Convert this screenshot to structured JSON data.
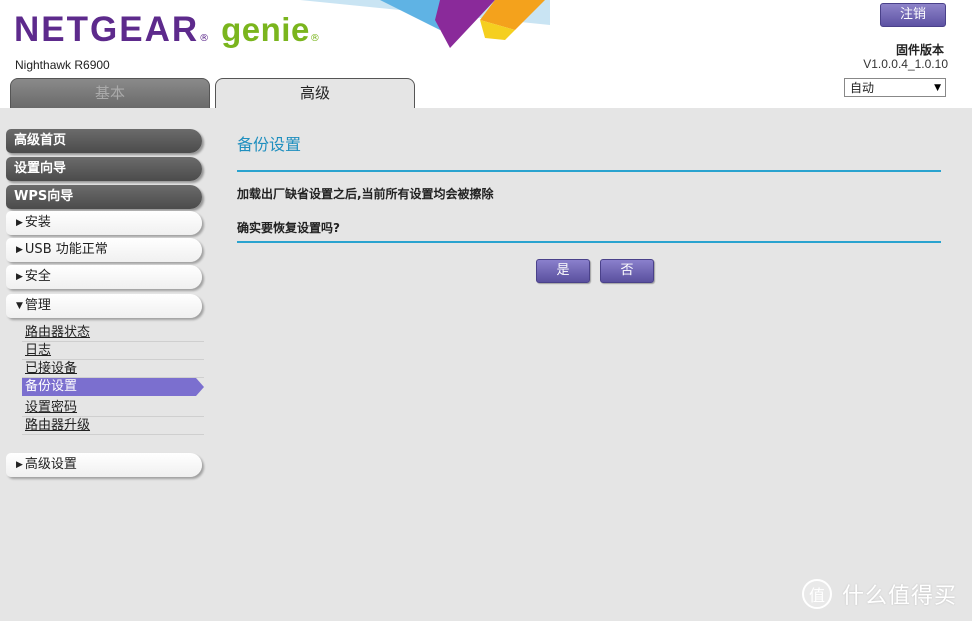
{
  "header": {
    "brand_netgear": "NETGEAR",
    "brand_genie": "genie",
    "brand_mark": "®",
    "model": "Nighthawk R6900",
    "logout_label": "注销",
    "firmware_label": "固件版本",
    "firmware_version": "V1.0.0.4_1.0.10",
    "language_selected": "自动",
    "tabs": {
      "basic": "基本",
      "advanced": "高级"
    }
  },
  "sidebar": {
    "advanced_home": "高级首页",
    "setup_wizard": "设置向导",
    "wps_wizard": "WPS向导",
    "setup": "安装",
    "usb": "USB 功能正常",
    "security": "安全",
    "administration": "管理",
    "admin_items": [
      "路由器状态",
      "日志",
      "已接设备",
      "备份设置",
      "设置密码",
      "路由器升级"
    ],
    "advanced_setup": "高级设置"
  },
  "content": {
    "title": "备份设置",
    "message1": "加载出厂缺省设置之后,当前所有设置均会被擦除",
    "message2": "确实要恢复设置吗?",
    "yes_label": "是",
    "no_label": "否"
  },
  "watermark": {
    "symbol": "值",
    "text": "什么值得买"
  },
  "colors": {
    "brand_purple": "#5d2a8c",
    "brand_green": "#7ab51d",
    "title_blue": "#1f8fbf",
    "rule_blue": "#2aa3cf",
    "button_purple": "#6b60b5",
    "active_item": "#7b6fcf"
  },
  "icons": {
    "collapsed": "triangle-right-icon",
    "expanded": "triangle-down-icon",
    "dropdown": "chevron-down-icon"
  }
}
